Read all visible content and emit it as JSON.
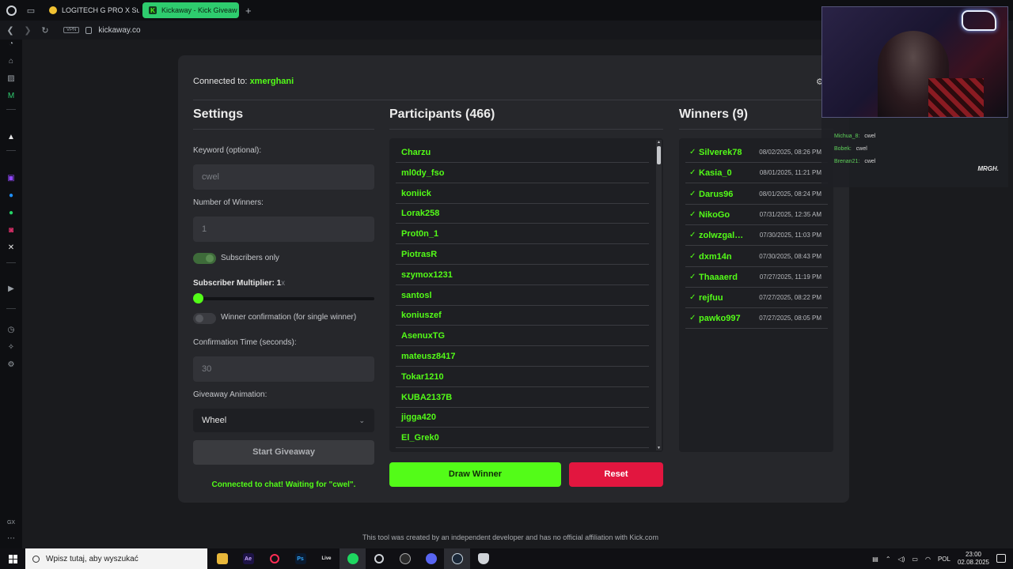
{
  "browser": {
    "tabs": [
      {
        "label": "LOGITECH G PRO X Supe"
      },
      {
        "label": "Kickaway - Kick Giveaw"
      }
    ],
    "vpn_label": "VPN",
    "url": "kickaway.co"
  },
  "app": {
    "connected_prefix": "Connected to:",
    "channel": "xmerghani",
    "settings": {
      "title": "Settings",
      "keyword_label": "Keyword (optional):",
      "keyword_placeholder": "cwel",
      "winners_label": "Number of Winners:",
      "winners_placeholder": "1",
      "subscribers_only_label": "Subscribers only",
      "subscribers_only": true,
      "multiplier_label": "Subscriber Multiplier: 1",
      "multiplier_unit": "x",
      "multiplier_value": 1,
      "confirmation_label": "Winner confirmation (for single winner)",
      "confirmation_enabled": false,
      "confirmation_time_label": "Confirmation Time (seconds):",
      "confirmation_time_placeholder": "30",
      "animation_label": "Giveaway Animation:",
      "animation_value": "Wheel",
      "start_button": "Start Giveaway",
      "status": "Connected to chat! Waiting for \"cwel\"."
    },
    "participants": {
      "title": "Participants (466)",
      "items": [
        "Charzu",
        "ml0dy_fso",
        "koniick",
        "Lorak258",
        "Prot0n_1",
        "PiotrasR",
        "szymox1231",
        "santosl",
        "koniuszef",
        "AsenuxTG",
        "mateusz8417",
        "Tokar1210",
        "KUBA2137B",
        "jigga420",
        "El_Grek0"
      ],
      "draw_button": "Draw Winner",
      "reset_button": "Reset"
    },
    "winners": {
      "title": "Winners (9)",
      "check_glyph": "✓",
      "items": [
        {
          "name": "Silverek78",
          "date": "08/02/2025, 08:26 PM"
        },
        {
          "name": "Kasia_0",
          "date": "08/01/2025, 11:21 PM"
        },
        {
          "name": "Darus96",
          "date": "08/01/2025, 08:24 PM"
        },
        {
          "name": "NikoGo",
          "date": "07/31/2025, 12:35 AM"
        },
        {
          "name": "zolwzgalaktyki",
          "date": "07/30/2025, 11:03 PM"
        },
        {
          "name": "dxm14n",
          "date": "07/30/2025, 08:43 PM"
        },
        {
          "name": "Thaaaerd",
          "date": "07/27/2025, 11:19 PM"
        },
        {
          "name": "rejfuu",
          "date": "07/27/2025, 08:22 PM"
        },
        {
          "name": "pawko997",
          "date": "07/27/2025, 08:05 PM"
        }
      ]
    },
    "footer": "This tool was created by an independent developer and has no official affiliation with Kick.com"
  },
  "stream_overlay": {
    "chat": [
      {
        "user": "Michua_8:",
        "msg": "cwel"
      },
      {
        "user": "Bobek:",
        "msg": "cwel"
      },
      {
        "user": "Brenan21:",
        "msg": "cwel"
      }
    ],
    "badge": "MRGH."
  },
  "taskbar": {
    "search_placeholder": "Wpisz tutaj, aby wyszukać",
    "apps": [
      "Ae",
      "Ps",
      "Live"
    ],
    "language": "POL",
    "time": "23:00",
    "date": "02.08.2025"
  },
  "colors": {
    "accent": "#53fc18",
    "danger": "#e2163f",
    "panel": "#26272b",
    "background": "#1a1b1e"
  }
}
